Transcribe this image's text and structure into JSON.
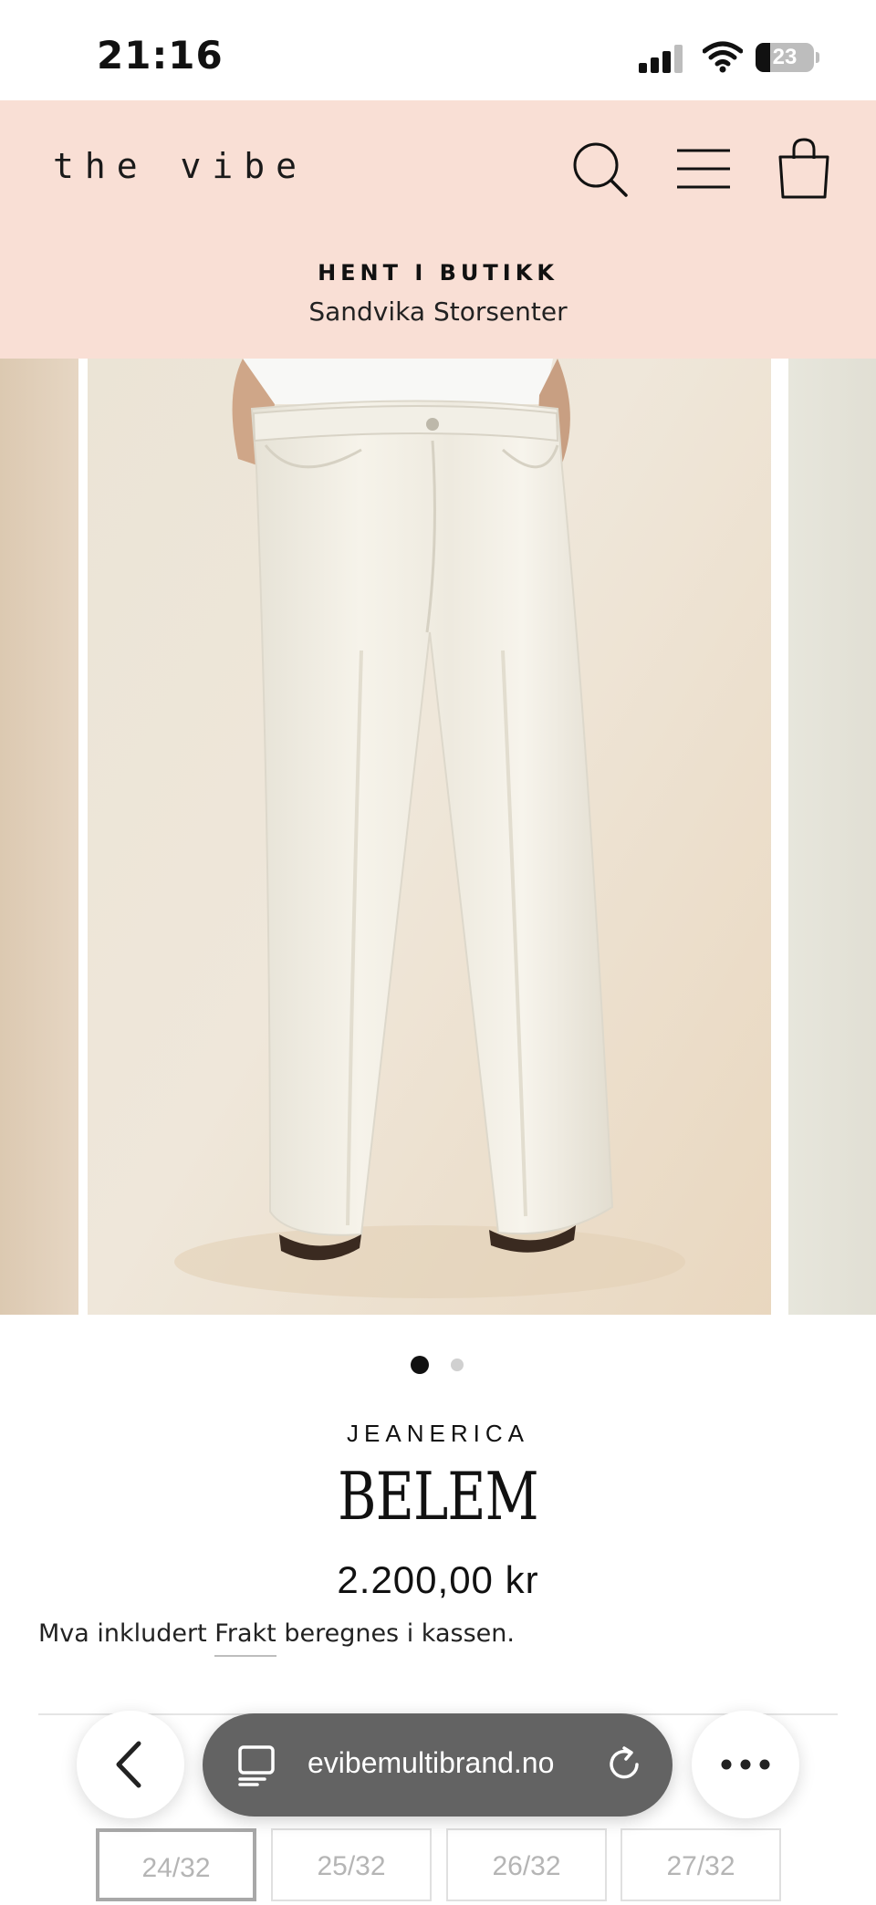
{
  "status_bar": {
    "time": "21:16",
    "battery": "23",
    "battery_level": 0.23
  },
  "header": {
    "logo": "the vibe",
    "icons": [
      "search-icon",
      "menu-icon",
      "cart-icon"
    ],
    "pickup_title": "HENT I BUTIKK",
    "pickup_store": "Sandvika Storsenter",
    "background": "#f9dfd5"
  },
  "gallery": {
    "slides": 2,
    "active": 1
  },
  "product": {
    "brand": "JEANERICA",
    "name": "BELEM",
    "price": "2.200,00 kr",
    "tax_prefix": "Mva inkludert",
    "shipping_link": "Frakt",
    "tax_suffix": "beregnes i kassen."
  },
  "sizes": [
    {
      "label": "24/32",
      "selected": true
    },
    {
      "label": "25/32",
      "selected": false
    },
    {
      "label": "26/32",
      "selected": false
    },
    {
      "label": "27/32",
      "selected": false
    }
  ],
  "browser": {
    "url": "evibemultibrand.no",
    "icons": [
      "back-icon",
      "tabs-icon",
      "reload-icon",
      "more-icon"
    ]
  }
}
